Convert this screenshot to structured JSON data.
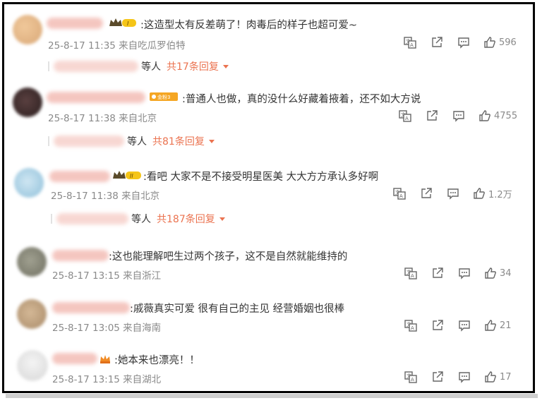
{
  "colors": {
    "accent": "#eb7350",
    "meta_text": "#8a8a8a",
    "body_text": "#333333",
    "border": "#000000"
  },
  "icons": [
    "translate-icon",
    "share-icon",
    "comment-icon",
    "thumbs-up-icon",
    "chevron-down-icon",
    "crown-level-icon",
    "fan-level-icon",
    "crown-icon"
  ],
  "badges": {
    "vip_1": "I",
    "fan": "金粉3",
    "vip_2": "II"
  },
  "comments": [
    {
      "text": ":这造型太有反差萌了！肉毒后的样子也超可爱~",
      "meta": "25-8-17 11:35 来自吃瓜罗伯特",
      "likes": "596",
      "reply_others": "等人",
      "reply_count": "共17条回复"
    },
    {
      "text": ":普通人也做，真的没什么好藏着掖着，还不如大方说",
      "meta": "25-8-17 11:38 来自北京",
      "likes": "4755",
      "reply_others": "等人",
      "reply_count": "共81条回复"
    },
    {
      "text": ":看吧 大家不是不接受明星医美 大大方方承认多好啊",
      "meta": "25-8-17 11:38 来自北京",
      "likes": "1.2万",
      "reply_others": "等人",
      "reply_count": "共187条回复"
    },
    {
      "text": ":这也能理解吧生过两个孩子，这不是自然就能维持的",
      "meta": "25-8-17 13:15 来自浙江",
      "likes": "34"
    },
    {
      "text": ":戚薇真实可爱 很有自己的主见 经营婚姻也很棒",
      "meta": "25-8-17 13:05 来自海南",
      "likes": "21"
    },
    {
      "text": ":她本来也漂亮！！",
      "meta": "25-8-17 13:15 来自湖北",
      "likes": "17"
    }
  ]
}
